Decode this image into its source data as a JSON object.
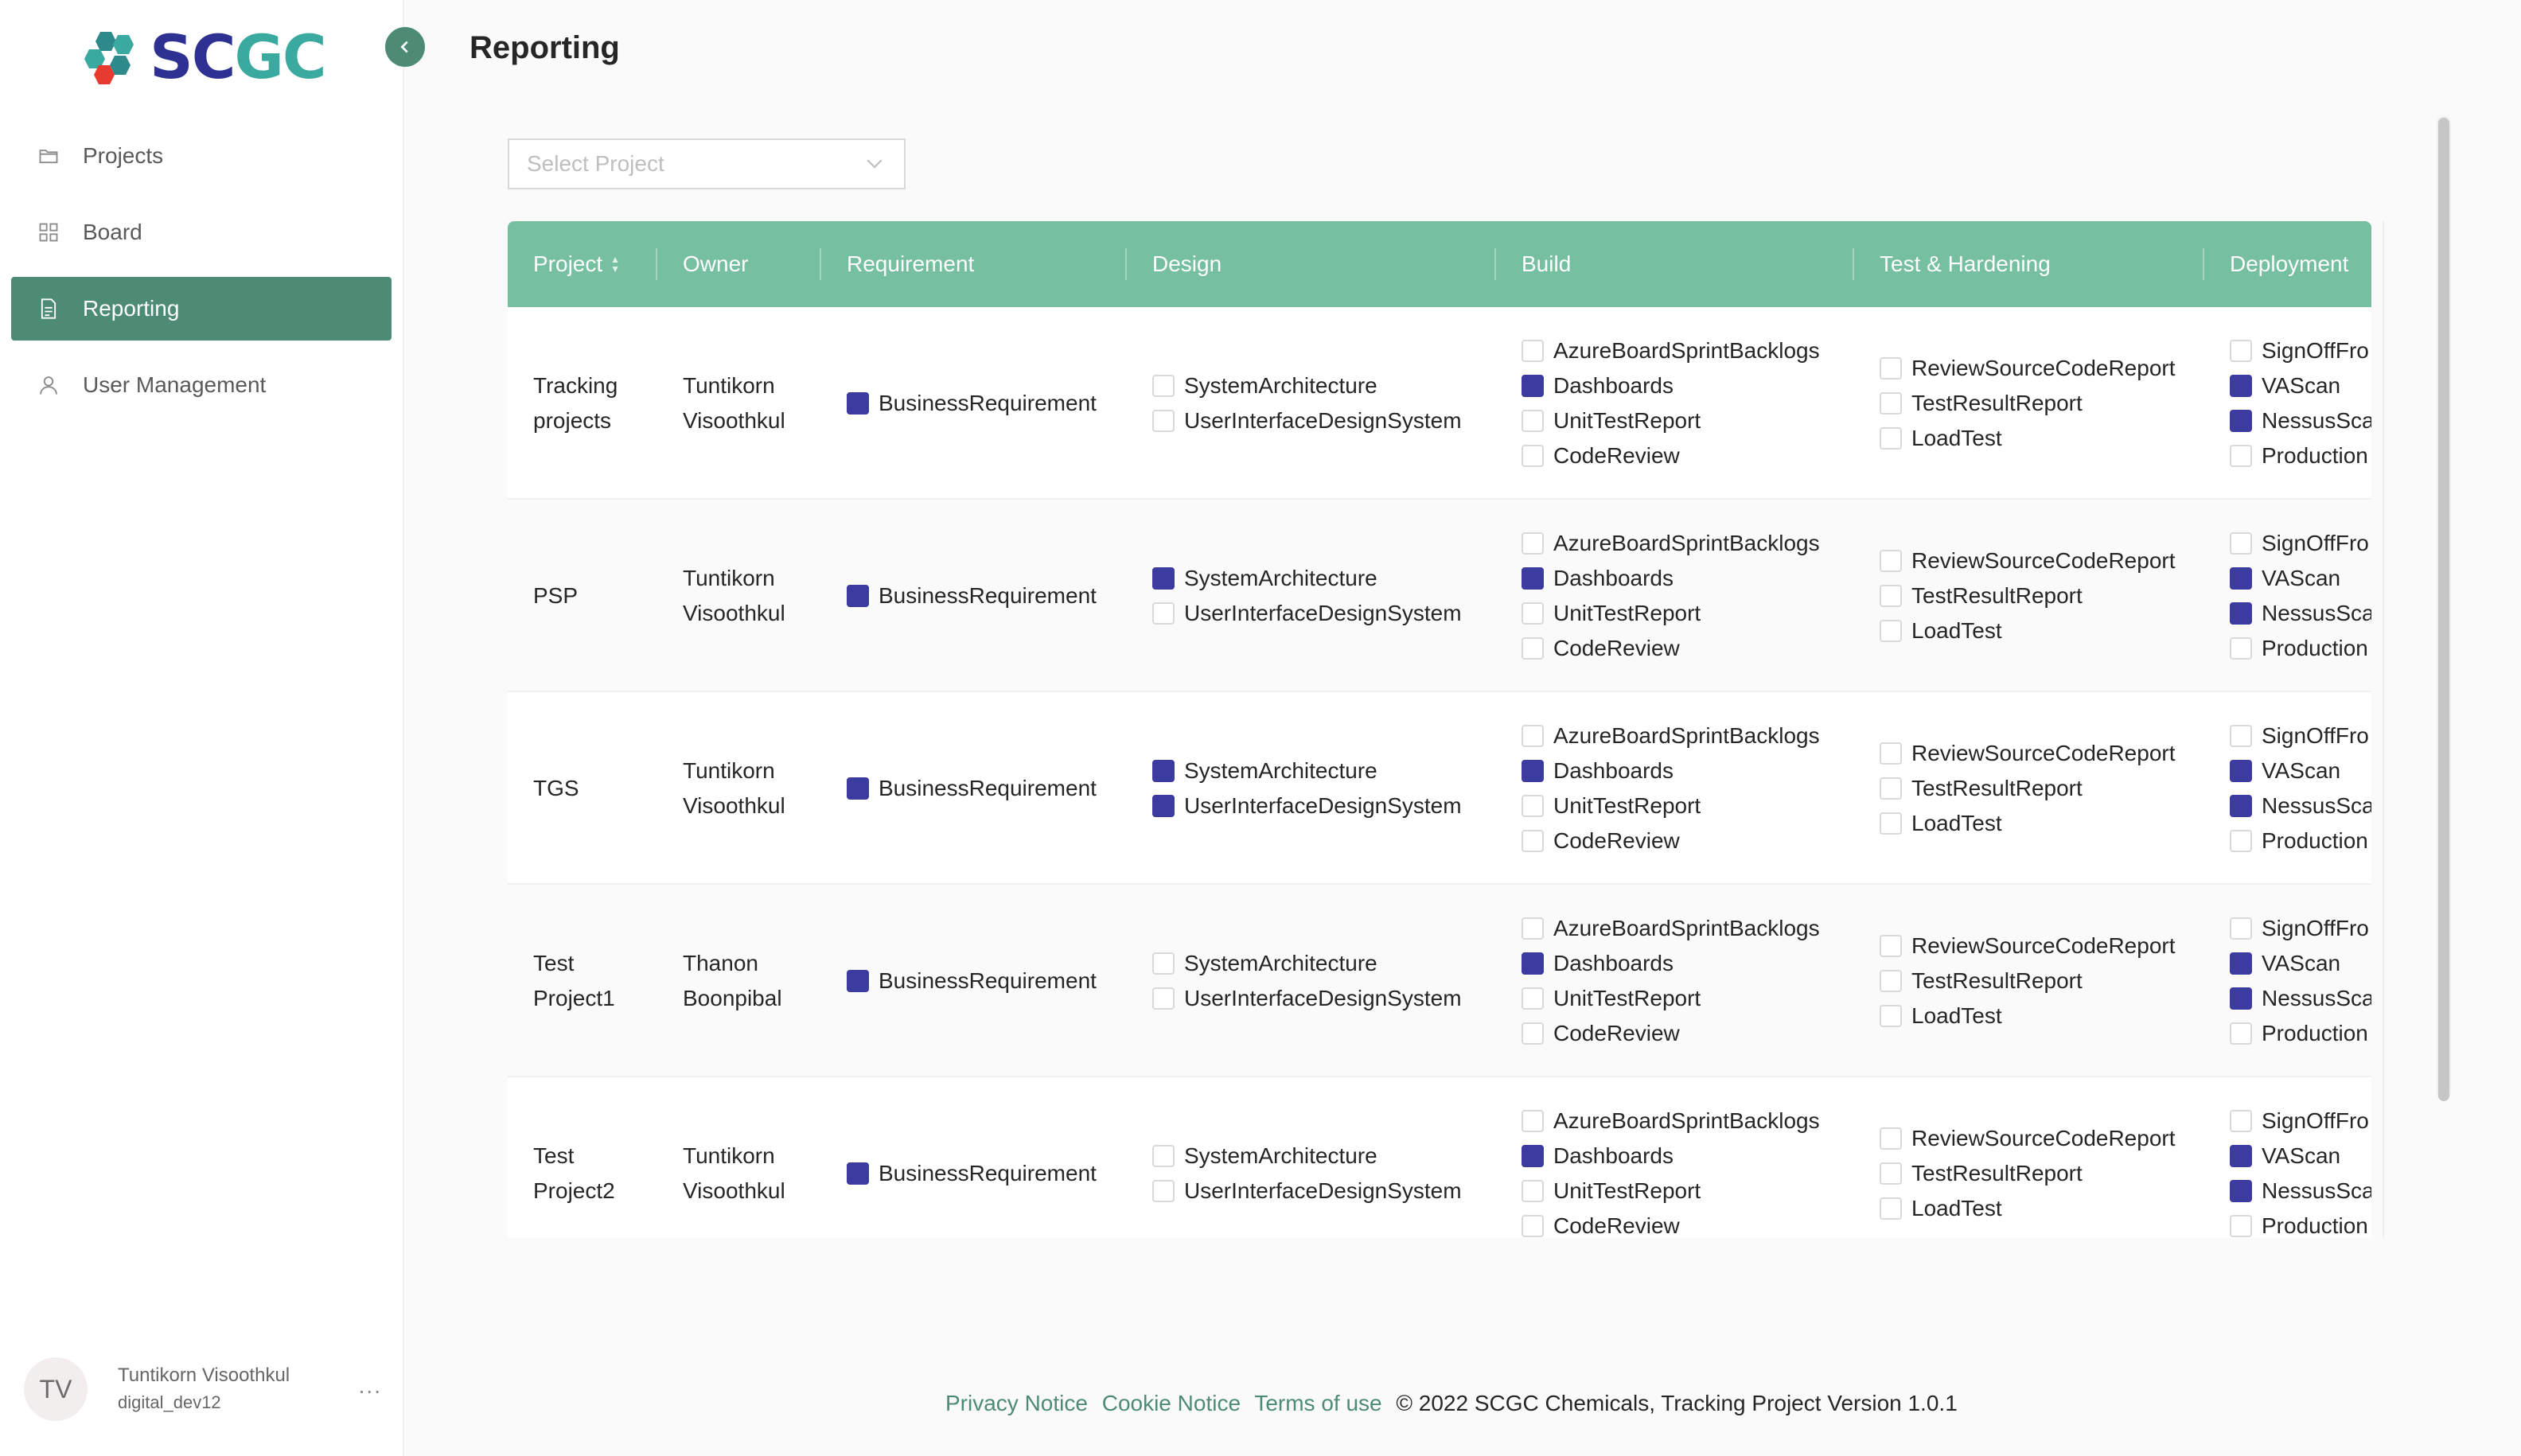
{
  "brand": {
    "logo_sc": "SC",
    "logo_gc": "GC",
    "colors": {
      "primary": "#4d8b75",
      "header": "#76bfa1",
      "checkbox_on": "#3c3ba0",
      "logo_blue": "#2e3192",
      "logo_teal": "#3aa99f"
    }
  },
  "sidebar": {
    "collapse_icon": "chevron-left-icon",
    "items": [
      {
        "label": "Projects",
        "icon": "folder-icon",
        "active": false
      },
      {
        "label": "Board",
        "icon": "grid-icon",
        "active": false
      },
      {
        "label": "Reporting",
        "icon": "file-icon",
        "active": true
      },
      {
        "label": "User Management",
        "icon": "user-icon",
        "active": false
      }
    ],
    "user": {
      "initials": "TV",
      "name": "Tuntikorn Visoothkul",
      "handle": "digital_dev12",
      "more": "..."
    }
  },
  "header": {
    "title": "Reporting"
  },
  "filter": {
    "placeholder": "Select Project"
  },
  "table": {
    "columns": [
      "Project",
      "Owner",
      "Requirement",
      "Design",
      "Build",
      "Test & Hardening",
      "Deployment"
    ],
    "rows": [
      {
        "project": [
          "Tracking",
          "projects"
        ],
        "owner": [
          "Tuntikorn",
          "Visoothkul"
        ],
        "requirement": [
          {
            "label": "BusinessRequirement",
            "checked": true
          }
        ],
        "design": [
          {
            "label": "SystemArchitecture",
            "checked": false
          },
          {
            "label": "UserInterfaceDesignSystem",
            "checked": false
          }
        ],
        "build": [
          {
            "label": "AzureBoardSprintBacklogs",
            "checked": false
          },
          {
            "label": "Dashboards",
            "checked": true
          },
          {
            "label": "UnitTestReport",
            "checked": false
          },
          {
            "label": "CodeReview",
            "checked": false
          }
        ],
        "test": [
          {
            "label": "ReviewSourceCodeReport",
            "checked": false
          },
          {
            "label": "TestResultReport",
            "checked": false
          },
          {
            "label": "LoadTest",
            "checked": false
          }
        ],
        "deployment": [
          {
            "label": "SignOffFro",
            "checked": false
          },
          {
            "label": "VAScan",
            "checked": true
          },
          {
            "label": "NessusSca",
            "checked": true
          },
          {
            "label": "Production",
            "checked": false
          }
        ]
      },
      {
        "project": [
          "PSP"
        ],
        "owner": [
          "Tuntikorn",
          "Visoothkul"
        ],
        "requirement": [
          {
            "label": "BusinessRequirement",
            "checked": true
          }
        ],
        "design": [
          {
            "label": "SystemArchitecture",
            "checked": true
          },
          {
            "label": "UserInterfaceDesignSystem",
            "checked": false
          }
        ],
        "build": [
          {
            "label": "AzureBoardSprintBacklogs",
            "checked": false
          },
          {
            "label": "Dashboards",
            "checked": true
          },
          {
            "label": "UnitTestReport",
            "checked": false
          },
          {
            "label": "CodeReview",
            "checked": false
          }
        ],
        "test": [
          {
            "label": "ReviewSourceCodeReport",
            "checked": false
          },
          {
            "label": "TestResultReport",
            "checked": false
          },
          {
            "label": "LoadTest",
            "checked": false
          }
        ],
        "deployment": [
          {
            "label": "SignOffFro",
            "checked": false
          },
          {
            "label": "VAScan",
            "checked": true
          },
          {
            "label": "NessusSca",
            "checked": true
          },
          {
            "label": "Production",
            "checked": false
          }
        ]
      },
      {
        "project": [
          "TGS"
        ],
        "owner": [
          "Tuntikorn",
          "Visoothkul"
        ],
        "requirement": [
          {
            "label": "BusinessRequirement",
            "checked": true
          }
        ],
        "design": [
          {
            "label": "SystemArchitecture",
            "checked": true
          },
          {
            "label": "UserInterfaceDesignSystem",
            "checked": true
          }
        ],
        "build": [
          {
            "label": "AzureBoardSprintBacklogs",
            "checked": false
          },
          {
            "label": "Dashboards",
            "checked": true
          },
          {
            "label": "UnitTestReport",
            "checked": false
          },
          {
            "label": "CodeReview",
            "checked": false
          }
        ],
        "test": [
          {
            "label": "ReviewSourceCodeReport",
            "checked": false
          },
          {
            "label": "TestResultReport",
            "checked": false
          },
          {
            "label": "LoadTest",
            "checked": false
          }
        ],
        "deployment": [
          {
            "label": "SignOffFro",
            "checked": false
          },
          {
            "label": "VAScan",
            "checked": true
          },
          {
            "label": "NessusSca",
            "checked": true
          },
          {
            "label": "Production",
            "checked": false
          }
        ]
      },
      {
        "project": [
          "Test",
          "Project1"
        ],
        "owner": [
          "Thanon",
          "Boonpibal"
        ],
        "requirement": [
          {
            "label": "BusinessRequirement",
            "checked": true
          }
        ],
        "design": [
          {
            "label": "SystemArchitecture",
            "checked": false
          },
          {
            "label": "UserInterfaceDesignSystem",
            "checked": false
          }
        ],
        "build": [
          {
            "label": "AzureBoardSprintBacklogs",
            "checked": false
          },
          {
            "label": "Dashboards",
            "checked": true
          },
          {
            "label": "UnitTestReport",
            "checked": false
          },
          {
            "label": "CodeReview",
            "checked": false
          }
        ],
        "test": [
          {
            "label": "ReviewSourceCodeReport",
            "checked": false
          },
          {
            "label": "TestResultReport",
            "checked": false
          },
          {
            "label": "LoadTest",
            "checked": false
          }
        ],
        "deployment": [
          {
            "label": "SignOffFro",
            "checked": false
          },
          {
            "label": "VAScan",
            "checked": true
          },
          {
            "label": "NessusSca",
            "checked": true
          },
          {
            "label": "Production",
            "checked": false
          }
        ]
      },
      {
        "project": [
          "Test",
          "Project2"
        ],
        "owner": [
          "Tuntikorn",
          "Visoothkul"
        ],
        "requirement": [
          {
            "label": "BusinessRequirement",
            "checked": true
          }
        ],
        "design": [
          {
            "label": "SystemArchitecture",
            "checked": false
          },
          {
            "label": "UserInterfaceDesignSystem",
            "checked": false
          }
        ],
        "build": [
          {
            "label": "AzureBoardSprintBacklogs",
            "checked": false
          },
          {
            "label": "Dashboards",
            "checked": true
          },
          {
            "label": "UnitTestReport",
            "checked": false
          },
          {
            "label": "CodeReview",
            "checked": false
          }
        ],
        "test": [
          {
            "label": "ReviewSourceCodeReport",
            "checked": false
          },
          {
            "label": "TestResultReport",
            "checked": false
          },
          {
            "label": "LoadTest",
            "checked": false
          }
        ],
        "deployment": [
          {
            "label": "SignOffFro",
            "checked": false
          },
          {
            "label": "VAScan",
            "checked": true
          },
          {
            "label": "NessusSca",
            "checked": true
          },
          {
            "label": "Production",
            "checked": false
          }
        ]
      }
    ]
  },
  "footer": {
    "links": [
      "Privacy Notice",
      "Cookie Notice",
      "Terms of use"
    ],
    "copyright": "© 2022 SCGC Chemicals, Tracking Project Version 1.0.1"
  }
}
